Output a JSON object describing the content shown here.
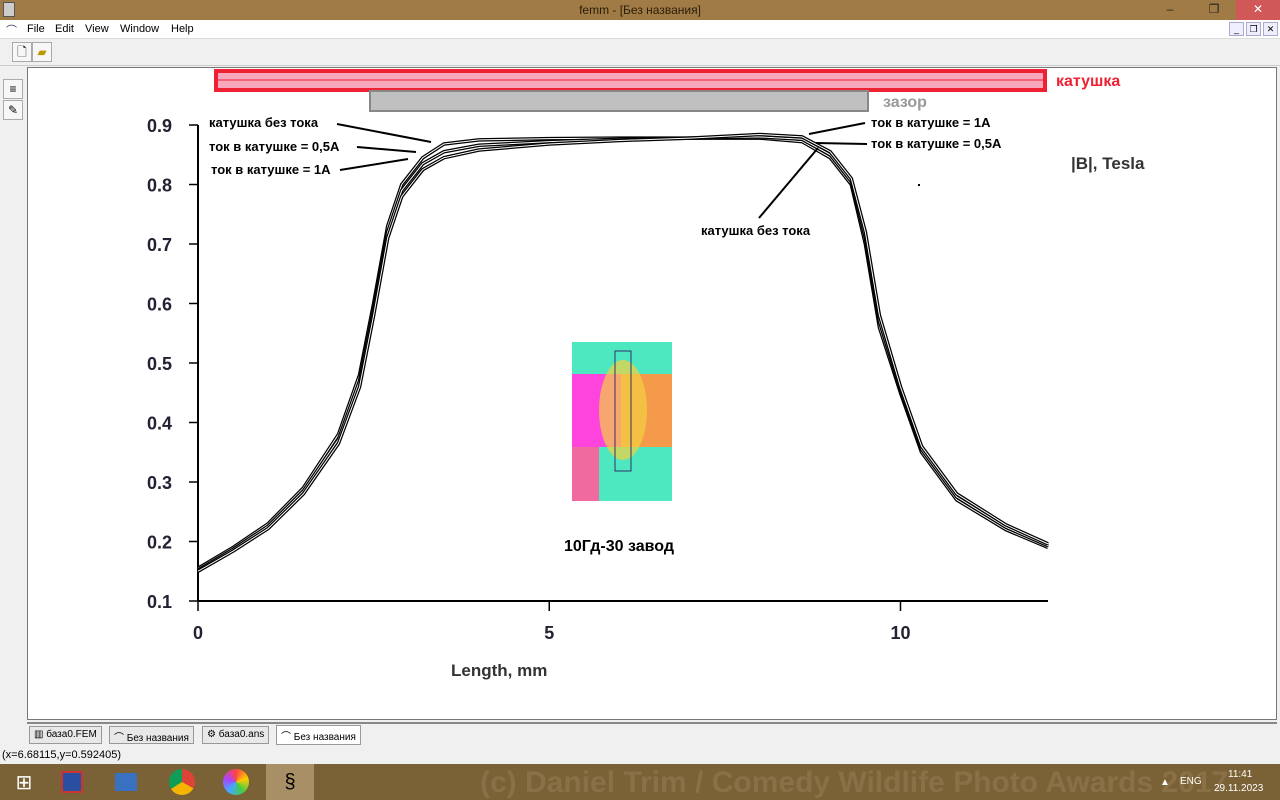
{
  "window": {
    "title": "femm - [Без названия]"
  },
  "menu": [
    "File",
    "Edit",
    "View",
    "Window",
    "Help"
  ],
  "tabs": [
    "база0.FEM",
    "Без названия",
    "база0.ans",
    "Без названия"
  ],
  "status": "(x=6.68115,y=0.592405)",
  "taskbar": {
    "lang": "ENG",
    "time": "11:41",
    "date": "29.11.2023",
    "watermark": "(c) Daniel Trim / Comedy Wildlife Photo Awards 2017"
  },
  "plot": {
    "legend_coil": "катушка",
    "legend_gap": "зазор",
    "caption": "10Гд-30 завод",
    "annotations_left": [
      "катушка без тока",
      "ток в катушке = 0,5А",
      "ток в катушке = 1А"
    ],
    "annotations_right": [
      "ток в катушке = 1А",
      "ток в катушке = 0,5А",
      "катушка без тока"
    ],
    "colors": {
      "coil": "#ee2233",
      "coil_fill": "#f7a8bc",
      "gap": "#c0c0c0"
    }
  },
  "chart_data": {
    "type": "line",
    "title": "",
    "ylabel": "|B|, Tesla",
    "xlabel": "Length, mm",
    "xlim": [
      0,
      12.1
    ],
    "ylim": [
      0.1,
      0.9
    ],
    "xticks": [
      "0",
      "5",
      "10"
    ],
    "xtick_values": [
      0,
      5,
      10
    ],
    "yticks": [
      "0.1",
      "0.2",
      "0.3",
      "0.4",
      "0.5",
      "0.6",
      "0.7",
      "0.8",
      "0.9"
    ],
    "x": [
      0,
      0.5,
      1,
      1.5,
      2,
      2.3,
      2.5,
      2.7,
      2.9,
      3.2,
      3.5,
      4,
      5,
      6,
      7,
      8,
      8.6,
      9,
      9.3,
      9.5,
      9.7,
      10,
      10.3,
      10.8,
      11.5,
      12.1
    ],
    "series": [
      {
        "name": "катушка без тока",
        "values": [
          0.155,
          0.19,
          0.23,
          0.29,
          0.38,
          0.48,
          0.6,
          0.73,
          0.8,
          0.845,
          0.868,
          0.875,
          0.877,
          0.878,
          0.878,
          0.878,
          0.872,
          0.845,
          0.8,
          0.7,
          0.56,
          0.45,
          0.35,
          0.27,
          0.22,
          0.19
        ]
      },
      {
        "name": "ток в катушке = 0,5А",
        "values": [
          0.152,
          0.187,
          0.226,
          0.285,
          0.372,
          0.47,
          0.59,
          0.72,
          0.79,
          0.835,
          0.855,
          0.866,
          0.872,
          0.876,
          0.878,
          0.88,
          0.876,
          0.85,
          0.805,
          0.71,
          0.57,
          0.455,
          0.355,
          0.275,
          0.224,
          0.193
        ]
      },
      {
        "name": "ток в катушке = 1А",
        "values": [
          0.15,
          0.184,
          0.222,
          0.28,
          0.365,
          0.46,
          0.58,
          0.71,
          0.78,
          0.825,
          0.845,
          0.858,
          0.868,
          0.874,
          0.878,
          0.884,
          0.88,
          0.855,
          0.81,
          0.72,
          0.58,
          0.46,
          0.36,
          0.28,
          0.228,
          0.196
        ]
      }
    ]
  }
}
